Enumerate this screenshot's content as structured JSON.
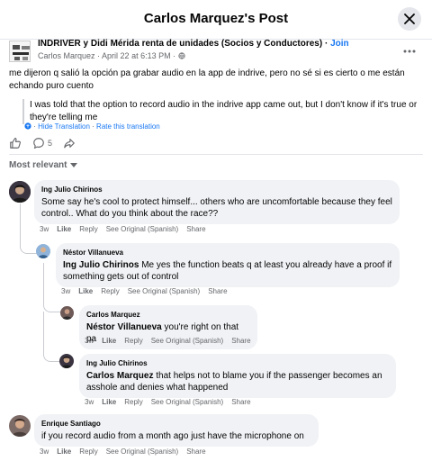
{
  "header": {
    "title": "Carlos Marquez's Post"
  },
  "post": {
    "group_name": "INDRIVER y Didi Mérida renta de unidades (Socios y Conductores)",
    "dot": " · ",
    "join_label": "Join",
    "author": "Carlos Marquez",
    "timestamp": "April 22 at 6:13 PM",
    "original_text": "me dijeron q salió la opción pa grabar audio en la app de indrive, pero no sé si es cierto o me están echando puro cuento",
    "translated_text": "I was told that the option to record audio in the indrive app came out, but I don't know if it's true or they're telling me",
    "hide_translation": "Hide Translation",
    "rate_translation": "Rate this translation",
    "comment_count": "5"
  },
  "sort": {
    "label": "Most relevant"
  },
  "comments": [
    {
      "author": "Ing Julio Chirinos",
      "text": "Some say he's cool to protect himself... others who are uncomfortable because they feel control.. What do you think about the race??",
      "time": "3w",
      "like": "Like",
      "reply": "Reply",
      "see_original": "See Original (Spanish)",
      "share": "Share"
    },
    {
      "author": "Néstor Villanueva",
      "mention": "Ing Julio Chirinos",
      "text": " Me yes the function beats q at least you already have a proof if something gets out of control",
      "time": "3w",
      "like": "Like",
      "reply": "Reply",
      "see_original": "See Original (Spanish)",
      "share": "Share"
    },
    {
      "author": "Carlos Marquez",
      "mention": "Néstor Villanueva",
      "text": " you're right on that pa",
      "time": "3w",
      "like": "Like",
      "reply": "Reply",
      "see_original": "See Original (Spanish)",
      "share": "Share"
    },
    {
      "author": "Ing Julio Chirinos",
      "mention": "Carlos Marquez",
      "text": " that helps not to blame you if the passenger becomes an asshole and denies what happened",
      "time": "3w",
      "like": "Like",
      "reply": "Reply",
      "see_original": "See Original (Spanish)",
      "share": "Share"
    },
    {
      "author": "Enrique Santiago",
      "text": "if you record audio from a month ago just have the microphone on",
      "time": "3w",
      "like": "Like",
      "reply": "Reply",
      "see_original": "See Original (Spanish)",
      "share": "Share"
    }
  ],
  "colors": {
    "link": "#1877f2",
    "bubble": "#f0f2f5",
    "secondary_text": "#65676b"
  }
}
